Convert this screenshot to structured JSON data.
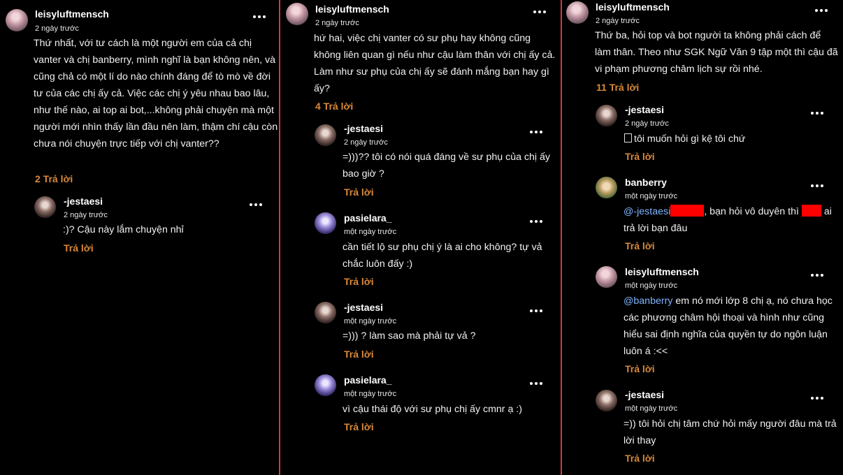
{
  "column1": {
    "post": {
      "username": "leisyluftmensch",
      "time": "2 ngày trước",
      "text": "Thứ nhất, với tư cách là một người em của cả chị vanter và chị banberry, mình nghĩ là bạn không nên, và cũng chả có một lí do nào chính đáng để tò mò về đời tư của các chị ấy cả. Việc các chị ý yêu nhau bao lâu, như thế nào, ai top ai bot,...không phải chuyện mà một người mới nhìn thấy lần đầu nên làm, thậm chí cậu còn chưa nói chuyện trực tiếp với chị vanter??",
      "reply_count": "2 Trả lời"
    },
    "replies": [
      {
        "username": "-jestaesi",
        "time": "2 ngày trước",
        "text": ":)? Cậu này lắm chuyện nhỉ",
        "reply": "Trả lời"
      }
    ]
  },
  "column2": {
    "post": {
      "username": "leisyluftmensch",
      "time": "2 ngày trước",
      "text": "hứ hai, việc chị vanter có sư phụ hay không cũng không liên quan gì nếu như cậu làm thân với chị ấy cả. Làm như sư phụ của chị ấy sẽ đánh mắng bạn hay gì ấy?",
      "reply_count": "4 Trả lời"
    },
    "replies": [
      {
        "username": "-jestaesi",
        "time": "2 ngày trước",
        "text": "=)))?? tôi có nói quá đáng về sư phụ của chị ấy bao giờ ?",
        "reply": "Trả lời"
      },
      {
        "username": "pasielara_",
        "time": "một ngày trước",
        "text": "cần tiết lộ sư phụ chị ý là ai cho không? tự vả chắc luôn đấy :)",
        "reply": "Trả lời"
      },
      {
        "username": "-jestaesi",
        "time": "một ngày trước",
        "text": "=))) ? làm sao mà phải tự vả ?",
        "reply": "Trả lời"
      },
      {
        "username": "pasielara_",
        "time": "một ngày trước",
        "text": "vì cậu thái độ với sư phụ chị ấy cmnr ạ :)",
        "reply": "Trả lời"
      }
    ]
  },
  "column3": {
    "post": {
      "username": "leisyluftmensch",
      "time": "2 ngày trước",
      "text": "Thứ ba, hỏi top và bot người ta không phải cách để làm thân. Theo như SGK Ngữ Văn 9 tập một thì cậu đã vi phạm phương châm lịch sự rồi nhé.",
      "reply_count": "11 Trả lời"
    },
    "replies": [
      {
        "username": "-jestaesi",
        "time": "2 ngày trước",
        "text": "tôi muốn hỏi gì kệ tôi chứ",
        "reply": "Trả lời"
      },
      {
        "username": "banberry",
        "time": "một ngày trước",
        "mention": "@-jestaesi",
        "text_a": ", bạn hỏi vô duyên thì",
        "text_b": "ai trả lời bạn đâu",
        "reply": "Trả lời"
      },
      {
        "username": "leisyluftmensch",
        "time": "một ngày trước",
        "mention": "@banberry",
        "text": "em nó mới lớp 8 chị ạ, nó chưa học các phương châm hội thoại và hình như cũng hiểu sai định nghĩa của quyền tự do ngôn luận luôn á :<<",
        "reply": "Trả lời"
      },
      {
        "username": "-jestaesi",
        "time": "một ngày trước",
        "text": "=)) tôi hỏi chị tâm chứ hỏi mấy người đâu mà trả lời thay",
        "reply": "Trả lời"
      }
    ]
  },
  "colors": {
    "background": "#000000",
    "divider": "#d23a3a",
    "reply_accent": "#d9893a",
    "mention": "#7fb4ff",
    "redaction": "#ff0000"
  },
  "icons": {
    "more": "more-options-icon",
    "checkbox": "checkbox-icon"
  }
}
